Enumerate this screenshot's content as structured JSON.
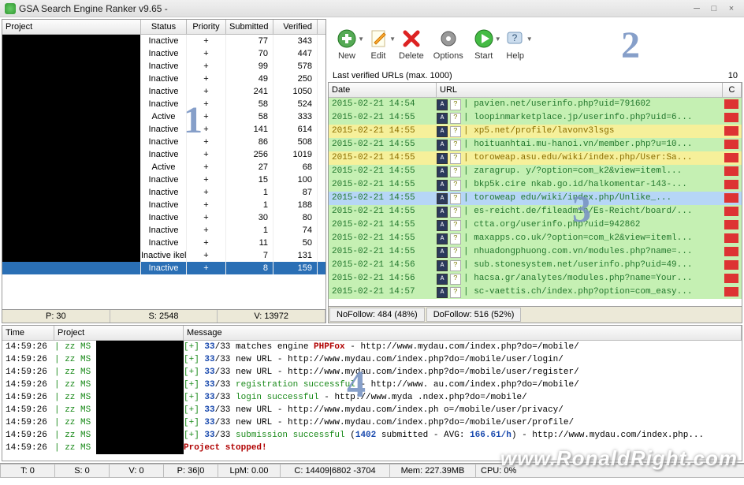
{
  "window": {
    "title": "GSA Search Engine Ranker v9.65 - "
  },
  "projects": {
    "headers": {
      "name": "Project",
      "status": "Status",
      "priority": "Priority",
      "submitted": "Submitted",
      "verified": "Verified"
    },
    "rows": [
      {
        "status": "Inactive",
        "priority": "+",
        "submitted": "77",
        "verified": "343"
      },
      {
        "status": "Inactive",
        "priority": "+",
        "submitted": "70",
        "verified": "447"
      },
      {
        "status": "Inactive",
        "priority": "+",
        "submitted": "99",
        "verified": "578"
      },
      {
        "status": "Inactive",
        "priority": "+",
        "submitted": "49",
        "verified": "250"
      },
      {
        "status": "Inactive",
        "priority": "+",
        "submitted": "241",
        "verified": "1050"
      },
      {
        "status": "Inactive",
        "priority": "+",
        "submitted": "58",
        "verified": "524"
      },
      {
        "status": "Active",
        "priority": "+",
        "submitted": "58",
        "verified": "333"
      },
      {
        "status": "Inactive",
        "priority": "+",
        "submitted": "141",
        "verified": "614"
      },
      {
        "status": "Inactive",
        "priority": "+",
        "submitted": "86",
        "verified": "508"
      },
      {
        "status": "Inactive",
        "priority": "+",
        "submitted": "256",
        "verified": "1019"
      },
      {
        "status": "Active",
        "priority": "+",
        "submitted": "27",
        "verified": "68"
      },
      {
        "status": "Inactive",
        "priority": "+",
        "submitted": "15",
        "verified": "100"
      },
      {
        "status": "Inactive",
        "priority": "+",
        "submitted": "1",
        "verified": "87"
      },
      {
        "status": "Inactive",
        "priority": "+",
        "submitted": "1",
        "verified": "188"
      },
      {
        "status": "Inactive",
        "priority": "+",
        "submitted": "30",
        "verified": "80"
      },
      {
        "status": "Inactive",
        "priority": "+",
        "submitted": "1",
        "verified": "74"
      },
      {
        "status": "Inactive",
        "priority": "+",
        "submitted": "11",
        "verified": "50"
      },
      {
        "status": "Inactive ikel ...",
        "priority": "+",
        "submitted": "7",
        "verified": "131"
      },
      {
        "status": "Inactive",
        "priority": "+",
        "submitted": "8",
        "verified": "159",
        "selected": true
      }
    ],
    "stats": {
      "p": "P: 30",
      "s": "S: 2548",
      "v": "V: 13972"
    }
  },
  "toolbar": [
    {
      "id": "new-button",
      "label": "New",
      "icon": "plus",
      "arrow": true
    },
    {
      "id": "edit-button",
      "label": "Edit",
      "icon": "edit",
      "arrow": true
    },
    {
      "id": "delete-button",
      "label": "Delete",
      "icon": "x",
      "arrow": false
    },
    {
      "id": "options-button",
      "label": "Options",
      "icon": "gear",
      "arrow": false
    },
    {
      "id": "start-button",
      "label": "Start",
      "icon": "play",
      "arrow": true
    },
    {
      "id": "help-button",
      "label": "Help",
      "icon": "help",
      "arrow": true
    }
  ],
  "urls": {
    "title": "Last verified URLs (max. 1000)",
    "count": "10",
    "headers": {
      "date": "Date",
      "url": "URL",
      "c": "C"
    },
    "rows": [
      {
        "date": "2015-02-21 14:54",
        "url": "pavien.net/userinfo.php?uid=791602",
        "bg": "green"
      },
      {
        "date": "2015-02-21 14:55",
        "url": "loopinmarketplace.jp/userinfo.php?uid=6...",
        "bg": "green"
      },
      {
        "date": "2015-02-21 14:55",
        "url": "xp5.net/profile/lavonv3lsgs",
        "bg": "yellow"
      },
      {
        "date": "2015-02-21 14:55",
        "url": "hoituanhtai.mu-hanoi.vn/member.php?u=10...",
        "bg": "green"
      },
      {
        "date": "2015-02-21 14:55",
        "url": "toroweap.asu.edu/wiki/index.php/User:Sa...",
        "bg": "yellow"
      },
      {
        "date": "2015-02-21 14:55",
        "url": "zaragrup.   y/?option=com_k2&view=iteml...",
        "bg": "green"
      },
      {
        "date": "2015-02-21 14:55",
        "url": "bkp5k.cire   nkab.go.id/halkomentar-143-...",
        "bg": "green"
      },
      {
        "date": "2015-02-21 14:55",
        "url": "toroweap     edu/wiki/index.php/Unlike_...",
        "bg": "sel"
      },
      {
        "date": "2015-02-21 14:55",
        "url": "es-reicht.de/fileadmin/Es-Reicht/board/...",
        "bg": "green"
      },
      {
        "date": "2015-02-21 14:55",
        "url": "ctta.org/userinfo.php?uid=942862",
        "bg": "green"
      },
      {
        "date": "2015-02-21 14:55",
        "url": "maxapps.co.uk/?option=com_k2&view=iteml...",
        "bg": "green"
      },
      {
        "date": "2015-02-21 14:55",
        "url": "nhuadongphuong.com.vn/modules.php?name=...",
        "bg": "green"
      },
      {
        "date": "2015-02-21 14:56",
        "url": "sub.stonesystem.net/userinfo.php?uid=49...",
        "bg": "green"
      },
      {
        "date": "2015-02-21 14:56",
        "url": "hacsa.gr/analytes/modules.php?name=Your...",
        "bg": "green"
      },
      {
        "date": "2015-02-21 14:57",
        "url": "sc-vaettis.ch/index.php?option=com_easy...",
        "bg": "green"
      }
    ],
    "follow": {
      "no": "NoFollow: 484 (48%)",
      "do": "DoFollow: 516 (52%)"
    }
  },
  "log": {
    "headers": {
      "time": "Time",
      "project": "Project",
      "message": "Message"
    },
    "rows": [
      {
        "time": "14:59:26",
        "proj": "| zz MS",
        "segments": [
          {
            "t": "[+] ",
            "c": "green"
          },
          {
            "t": "33",
            "c": "blue"
          },
          {
            "t": "/33 matches engine ",
            "c": ""
          },
          {
            "t": "PHPFox",
            "c": "red"
          },
          {
            "t": " - http://www.mydau.com/index.php?do=/mobile/",
            "c": ""
          }
        ]
      },
      {
        "time": "14:59:26",
        "proj": "| zz MS",
        "segments": [
          {
            "t": "[+] ",
            "c": "green"
          },
          {
            "t": "33",
            "c": "blue"
          },
          {
            "t": "/33 new URL - http://www.mydau.com/index.php?do=/mobile/user/login/",
            "c": ""
          }
        ]
      },
      {
        "time": "14:59:26",
        "proj": "| zz MS",
        "segments": [
          {
            "t": "[+] ",
            "c": "green"
          },
          {
            "t": "33",
            "c": "blue"
          },
          {
            "t": "/33 new URL - http://www.mydau.com/index.php?do=/mobile/user/register/",
            "c": ""
          }
        ]
      },
      {
        "time": "14:59:26",
        "proj": "| zz MS",
        "segments": [
          {
            "t": "[+] ",
            "c": "green"
          },
          {
            "t": "33",
            "c": "blue"
          },
          {
            "t": "/33 ",
            "c": ""
          },
          {
            "t": "registration successful",
            "c": "green"
          },
          {
            "t": " - http://www.   au.com/index.php?do=/mobile/",
            "c": ""
          }
        ]
      },
      {
        "time": "14:59:26",
        "proj": "| zz MS",
        "segments": [
          {
            "t": "[+] ",
            "c": "green"
          },
          {
            "t": "33",
            "c": "blue"
          },
          {
            "t": "/33 ",
            "c": ""
          },
          {
            "t": "login successful",
            "c": "green"
          },
          {
            "t": " - http://www.myda    .ndex.php?do=/mobile/",
            "c": ""
          }
        ]
      },
      {
        "time": "14:59:26",
        "proj": "| zz MS",
        "segments": [
          {
            "t": "[+] ",
            "c": "green"
          },
          {
            "t": "33",
            "c": "blue"
          },
          {
            "t": "/33 new URL - http://www.mydau.com/index.ph  o=/mobile/user/privacy/",
            "c": ""
          }
        ]
      },
      {
        "time": "14:59:26",
        "proj": "| zz MS",
        "segments": [
          {
            "t": "[+] ",
            "c": "green"
          },
          {
            "t": "33",
            "c": "blue"
          },
          {
            "t": "/33 new URL - http://www.mydau.com/index.php?do=/mobile/user/profile/",
            "c": ""
          }
        ]
      },
      {
        "time": "14:59:26",
        "proj": "| zz MS",
        "segments": [
          {
            "t": "[+] ",
            "c": "green"
          },
          {
            "t": "33",
            "c": "blue"
          },
          {
            "t": "/33 ",
            "c": ""
          },
          {
            "t": "submission successful",
            "c": "green"
          },
          {
            "t": " (",
            "c": ""
          },
          {
            "t": "1402",
            "c": "blue"
          },
          {
            "t": " submitted - AVG: ",
            "c": ""
          },
          {
            "t": "166.61/h",
            "c": "blue"
          },
          {
            "t": ") - http://www.mydau.com/index.php...",
            "c": ""
          }
        ]
      },
      {
        "time": "14:59:26",
        "proj": "| zz MS",
        "segments": [
          {
            "t": "Project stopped!",
            "c": "red"
          }
        ]
      }
    ]
  },
  "status": {
    "t": "T: 0",
    "s": "S: 0",
    "v": "V: 0",
    "p": "P: 36|0",
    "lpm": "LpM: 0.00",
    "c": "C: 14409|6802 -3704",
    "mem": "Mem: 227.39MB",
    "cpu": "CPU: 0%"
  },
  "overlays": {
    "n1": "1",
    "n2": "2",
    "n3": "3",
    "n4": "4",
    "watermark": "www.RonaldRight.com"
  }
}
